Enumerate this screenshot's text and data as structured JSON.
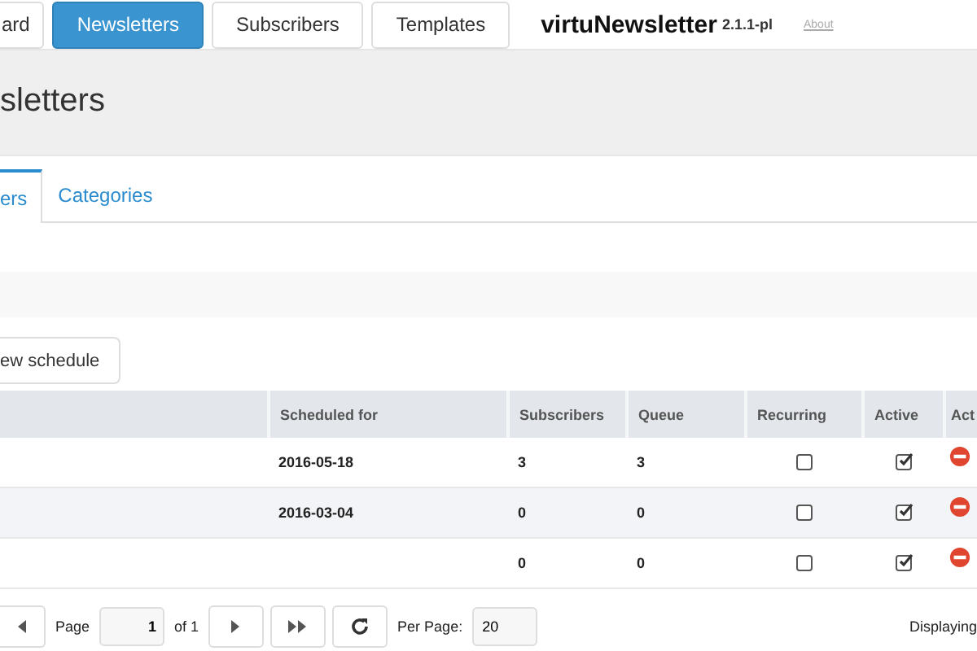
{
  "nav": {
    "buttons": [
      {
        "label": "ard",
        "selected": false
      },
      {
        "label": "Newsletters",
        "selected": true
      },
      {
        "label": "Subscribers",
        "selected": false
      },
      {
        "label": "Templates",
        "selected": false
      }
    ],
    "brand": "virtuNewsletter",
    "version": "2.1.1-pl",
    "about": "About"
  },
  "page_title": "sletters",
  "tabs": [
    {
      "label": "ers",
      "selected": true
    },
    {
      "label": "Categories",
      "selected": false
    }
  ],
  "new_button": "ew schedule",
  "table": {
    "columns": [
      "",
      "Scheduled for",
      "Subscribers",
      "Queue",
      "Recurring",
      "Active",
      "Act"
    ],
    "rows": [
      {
        "scheduled_for": "2016-05-18",
        "subscribers": "3",
        "queue": "3",
        "recurring": false,
        "active": true
      },
      {
        "scheduled_for": "2016-03-04",
        "subscribers": "0",
        "queue": "0",
        "recurring": false,
        "active": true
      },
      {
        "scheduled_for": "",
        "subscribers": "0",
        "queue": "0",
        "recurring": false,
        "active": true
      }
    ]
  },
  "pager": {
    "page_label": "Page",
    "page": "1",
    "of": "of 1",
    "per_page_label": "Per Page:",
    "per_page": "20",
    "displaying": "Displaying"
  }
}
